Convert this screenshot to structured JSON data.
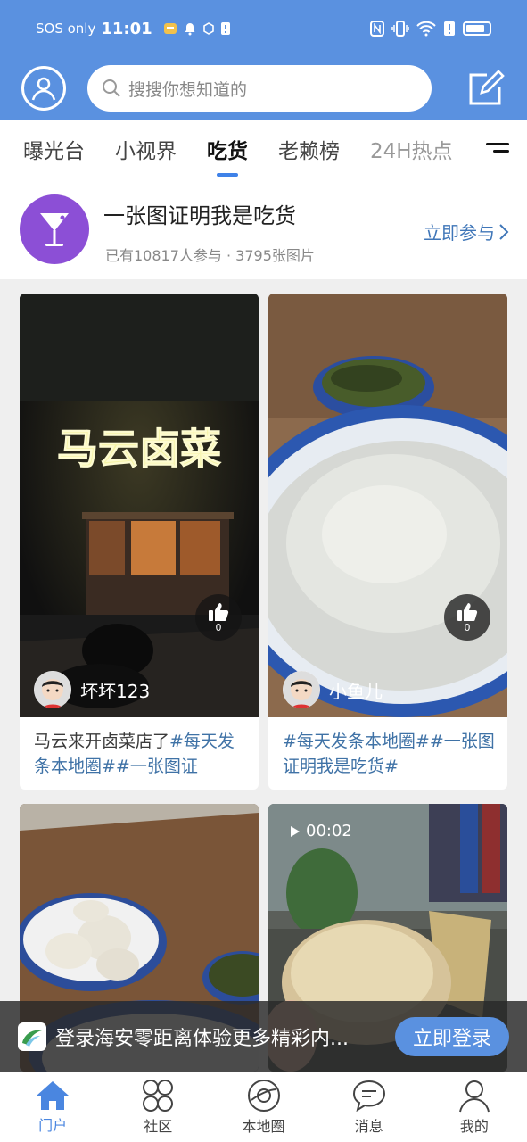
{
  "status_bar": {
    "carrier": "SOS only",
    "time": "11:01"
  },
  "search": {
    "placeholder": "搜搜你想知道的"
  },
  "tabs": [
    {
      "label": "曝光台"
    },
    {
      "label": "小视界"
    },
    {
      "label": "吃货"
    },
    {
      "label": "老赖榜"
    },
    {
      "label": "24H热点"
    }
  ],
  "topic": {
    "title": "一张图证明我是吃货",
    "stats": "已有10817人参与 · 3795张图片",
    "join_label": "立即参与"
  },
  "posts": [
    {
      "sign_text": "马云卤菜",
      "likes": "0",
      "username": "坏坏123",
      "caption_plain": "马云来开卤菜店了",
      "caption_tag": "#每天发条本地圈##一张图证"
    },
    {
      "likes": "0",
      "username": "小鱼儿",
      "caption_plain": "",
      "caption_tag": "#每天发条本地圈##一张图证明我是吃货#"
    },
    {
      "username": ""
    },
    {
      "video_duration": "00:02"
    }
  ],
  "login_banner": {
    "text": "登录海安零距离体验更多精彩内...",
    "button": "立即登录"
  },
  "bottom_nav": [
    {
      "label": "门户"
    },
    {
      "label": "社区"
    },
    {
      "label": "本地圈"
    },
    {
      "label": "消息"
    },
    {
      "label": "我的"
    }
  ],
  "colors": {
    "brand_blue": "#5a91e0",
    "tag_blue": "#3f72a6",
    "topic_purple": "#8c4fd6"
  }
}
